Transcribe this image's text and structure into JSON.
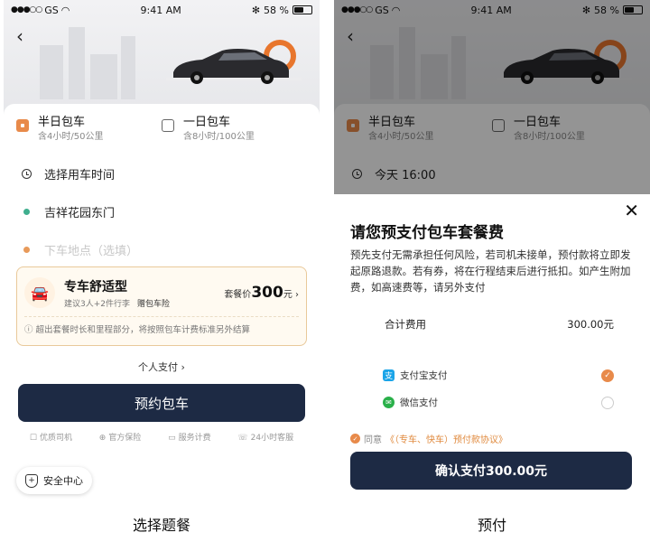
{
  "status_bar": {
    "carrier": "GS",
    "time": "9:41 AM",
    "battery": "58 %",
    "battery_level": 0.58
  },
  "left": {
    "options": [
      {
        "title": "半日包车",
        "sub": "含4小时/50公里",
        "checked": true
      },
      {
        "title": "一日包车",
        "sub": "含8小时/100公里",
        "checked": false
      }
    ],
    "time_field": "选择用车时间",
    "pickup_field": "吉祥花园东门",
    "dropoff_placeholder": "下车地点（选填）",
    "package": {
      "name": "专车舒适型",
      "sub": "建议3人+2件行李",
      "tag": "赠包车险",
      "price_prefix": "套餐价",
      "price": "300",
      "price_suffix": "元",
      "note": "超出套餐时长和里程部分，将按照包车计费标准另外结算"
    },
    "personal_pay": "个人支付 ›",
    "book_button": "预约包车",
    "features": [
      "优质司机",
      "官方保险",
      "服务计费",
      "24小时客服"
    ],
    "safety": "安全中心",
    "caption": "选择题餐"
  },
  "right": {
    "time_field": "今天 16:00",
    "sheet": {
      "title": "请您预支付包车套餐费",
      "desc": "预先支付无需承担任何风险，若司机未接单，预付款将立即发起原路退款。若有券，将在行程结束后进行抵扣。如产生附加费，如高速费等，请另外支付",
      "total_label": "合计费用",
      "total_value": "300.00元",
      "payment_methods": [
        {
          "label": "支付宝支付",
          "selected": true
        },
        {
          "label": "微信支付",
          "selected": false
        }
      ],
      "agree_prefix": "同意",
      "agree_link": "《（专车、快车）预付款协议》",
      "confirm_button": "确认支付300.00元"
    },
    "caption": "预付"
  },
  "colors": {
    "accent": "#e88a4a",
    "primary_button": "#1d2a44",
    "package_border": "#e9c99a"
  }
}
